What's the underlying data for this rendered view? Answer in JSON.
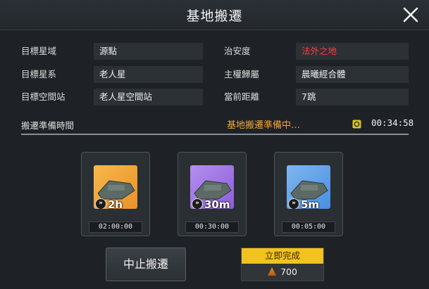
{
  "title": "基地搬遷",
  "info": {
    "rows": [
      {
        "label": "目標星域",
        "value": "源點"
      },
      {
        "label": "目標星系",
        "value": "老人星"
      },
      {
        "label": "目標空間站",
        "value": "老人星空間站"
      }
    ],
    "rows_right": [
      {
        "label": "治安度",
        "value": "法外之地",
        "color": "#ff3b3b"
      },
      {
        "label": "主權歸屬",
        "value": "晨曦經合體"
      },
      {
        "label": "當前距離",
        "value": "7跳"
      }
    ]
  },
  "prep": {
    "label": "搬遷準備時間",
    "status": "基地搬遷準備中…",
    "timer": "00:34:58"
  },
  "options": [
    {
      "speed": "2h",
      "time": "02:00:00",
      "color": "#f2a238"
    },
    {
      "speed": "30m",
      "time": "00:30:00",
      "color": "#a57be8"
    },
    {
      "speed": "5m",
      "time": "00:05:00",
      "color": "#5aa2e8"
    }
  ],
  "buttons": {
    "cancel": "中止搬遷",
    "finish": "立即完成",
    "finish_cost": "700"
  }
}
